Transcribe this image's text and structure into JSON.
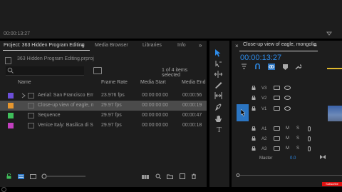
{
  "top_monitor": {
    "timecode": "00:00:13:27"
  },
  "project_panel": {
    "tabs": [
      {
        "label": "Project: 363 Hidden Program Editing",
        "active": true
      },
      {
        "label": "Media Browser"
      },
      {
        "label": "Libraries"
      },
      {
        "label": "Info"
      }
    ],
    "project_file": "363 Hidden Program Editing.prproj",
    "items_selected": "1 of 4 items selected",
    "columns": [
      "Name",
      "Frame Rate",
      "Media Start",
      "Media End"
    ],
    "rows": [
      {
        "name": "Aerial: San Francisco Embar",
        "frame_rate": "23.976 fps",
        "media_start": "00:00:00:00",
        "media_end": "00:00:56",
        "swatch": "#6b4fd8",
        "selected": false
      },
      {
        "name": "Close-up view of eagle, mo",
        "frame_rate": "29.97 fps",
        "media_start": "00:00:00:00",
        "media_end": "00:00:19",
        "swatch": "#e6962e",
        "selected": true
      },
      {
        "name": "Sequence",
        "frame_rate": "29.97 fps",
        "media_start": "00:00:00:00",
        "media_end": "00:00:47",
        "swatch": "#3fbe5a",
        "selected": false
      },
      {
        "name": "Venice Italy: Basilica di San",
        "frame_rate": "29.97 fps",
        "media_start": "00:00:00:00",
        "media_end": "00:00:18",
        "swatch": "#c23fbf",
        "selected": false
      }
    ]
  },
  "timeline": {
    "sequence_name": "Close-up view of eagle, mongolia",
    "timecode": "00:00:13:27",
    "video_tracks": [
      "V3",
      "V2",
      "V1"
    ],
    "audio_tracks": [
      "A1",
      "A2",
      "A3"
    ],
    "master_label": "Master",
    "master_value": "0.0",
    "mute_label": "M",
    "solo_label": "S"
  },
  "overlay": {
    "subscribe_label": "Subscribe"
  },
  "colors": {
    "accent": "#2d8ceb",
    "selected_row": "#4b4b4b",
    "panel": "#1d1d1d"
  }
}
